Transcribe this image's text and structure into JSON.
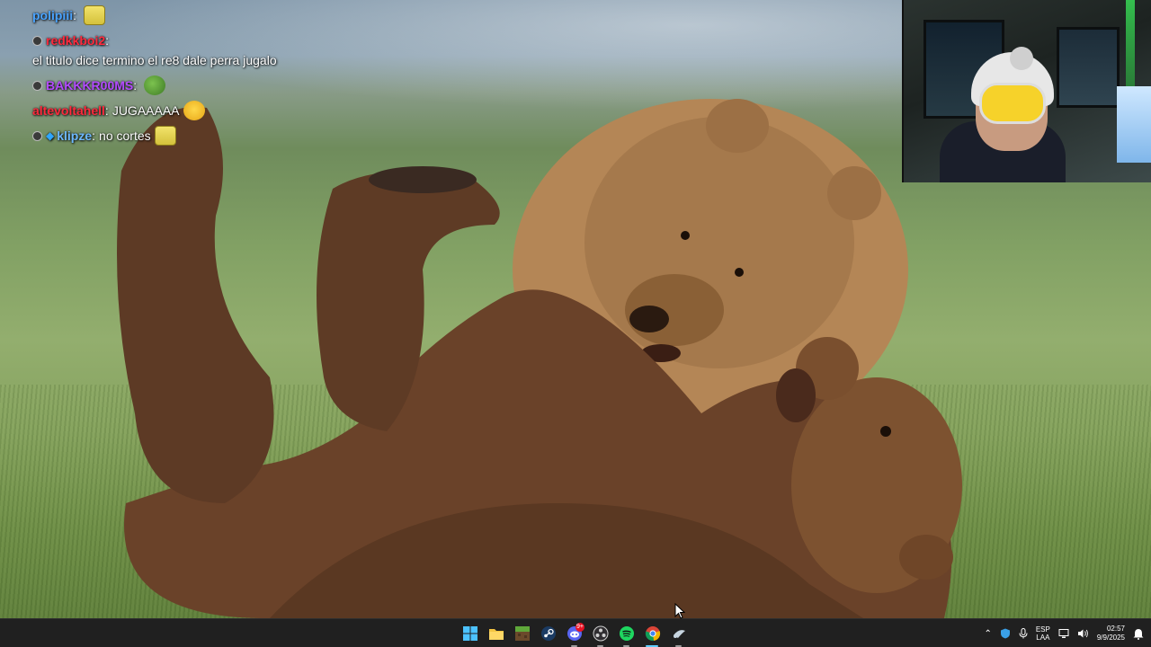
{
  "wallpaper": {
    "subject": "two brown bears playing in a meadow"
  },
  "chat": {
    "messages": [
      {
        "user": "polipiii",
        "user_color": "#4aa3ff",
        "text": "",
        "emote": "spongebob-emote",
        "badge": false
      },
      {
        "user": "redkkboi2",
        "user_color": "#ff2a3d",
        "text": "el titulo dice termino el re8 dale perra jugalo",
        "emote": "",
        "badge": true
      },
      {
        "user": "BAKKKR00MS",
        "user_color": "#b44cff",
        "text": "",
        "emote": "pepe-emote",
        "badge": true
      },
      {
        "user": "altevoltahell",
        "user_color": "#ff2a3d",
        "text": "JUGAAAAA",
        "emote": "laughing-emote",
        "badge": false
      },
      {
        "user": "klipze",
        "user_color": "#6db8ff",
        "text": "no cortes",
        "emote": "spongebob-emote",
        "badge": true,
        "gem": true
      }
    ]
  },
  "webcam": {
    "description": "streamer covering face with hands, wearing beanie and headset"
  },
  "taskbar": {
    "apps": [
      {
        "name": "start-icon",
        "indicator": false,
        "badge": ""
      },
      {
        "name": "file-explorer-icon",
        "indicator": false,
        "badge": ""
      },
      {
        "name": "minecraft-icon",
        "indicator": false,
        "badge": ""
      },
      {
        "name": "steam-icon",
        "indicator": false,
        "badge": ""
      },
      {
        "name": "discord-icon",
        "indicator": true,
        "badge": "9+"
      },
      {
        "name": "obs-icon",
        "indicator": true,
        "badge": ""
      },
      {
        "name": "spotify-icon",
        "indicator": true,
        "badge": ""
      },
      {
        "name": "chrome-icon",
        "indicator": "active",
        "badge": ""
      },
      {
        "name": "steam-app-icon",
        "indicator": true,
        "badge": ""
      }
    ],
    "tray": {
      "lang_top": "ESP",
      "lang_bottom": "LAA",
      "time": "02:57",
      "date": "9/9/2025"
    }
  },
  "colors": {
    "taskbar_bg": "#202020",
    "active_indicator": "#60cdff",
    "chrome_red": "#db4437",
    "spotify_green": "#1ed760",
    "discord_blurple": "#5865f2"
  }
}
